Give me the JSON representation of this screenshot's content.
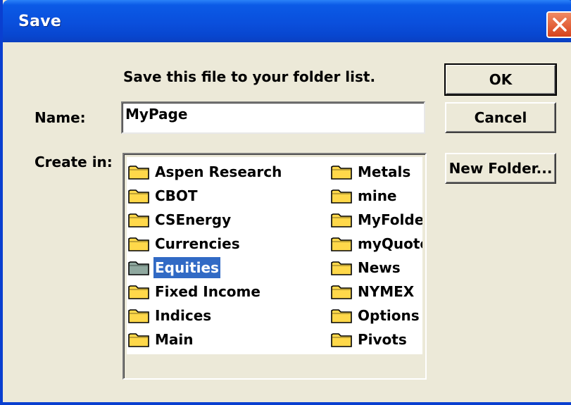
{
  "window": {
    "title": "Save",
    "close_icon": "close-icon"
  },
  "prompt": "Save this file to your folder list.",
  "name_field": {
    "label": "Name:",
    "value": "MyPage"
  },
  "create_in": {
    "label": "Create in:"
  },
  "buttons": {
    "ok": "OK",
    "cancel": "Cancel",
    "new_folder": "New Folder..."
  },
  "folders": {
    "column1": [
      {
        "label": "Aspen Research",
        "selected": false
      },
      {
        "label": "CBOT",
        "selected": false
      },
      {
        "label": "CSEnergy",
        "selected": false
      },
      {
        "label": "Currencies",
        "selected": false
      },
      {
        "label": "Equities",
        "selected": true
      },
      {
        "label": "Fixed Income",
        "selected": false
      },
      {
        "label": "Indices",
        "selected": false
      },
      {
        "label": "Main",
        "selected": false
      }
    ],
    "column2": [
      {
        "label": "Metals",
        "selected": false
      },
      {
        "label": "mine",
        "selected": false
      },
      {
        "label": "MyFolde",
        "selected": false
      },
      {
        "label": "myQuote",
        "selected": false
      },
      {
        "label": "News",
        "selected": false
      },
      {
        "label": "NYMEX",
        "selected": false
      },
      {
        "label": "Options",
        "selected": false
      },
      {
        "label": "Pivots",
        "selected": false
      }
    ]
  },
  "colors": {
    "title_bar": "#0a4fdc",
    "dialog_bg": "#ece9d8",
    "selection": "#316ac5",
    "folder": "#ffd84a",
    "folder_selected": "#8fa89f"
  }
}
